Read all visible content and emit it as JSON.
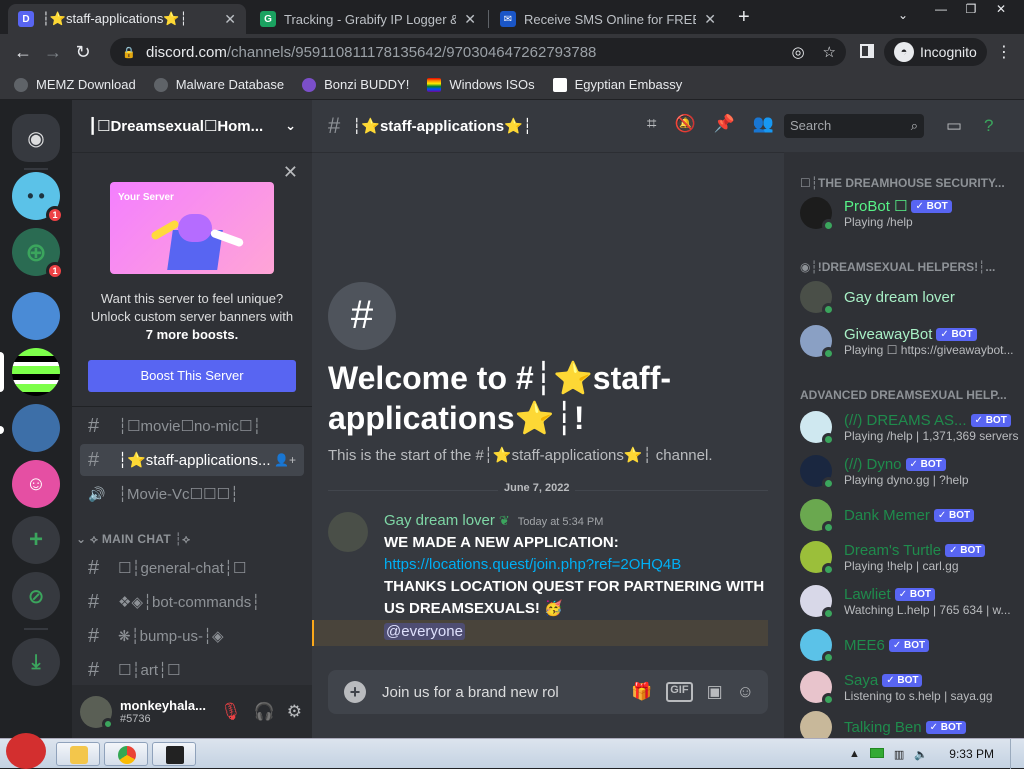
{
  "browser": {
    "tabs": [
      {
        "title": "┆⭐staff-applications⭐┆",
        "close": "✕",
        "icon": "discord-tab-icon"
      },
      {
        "title": "Tracking - Grabify IP Logger &",
        "close": "✕",
        "icon": "grabify-tab-icon"
      },
      {
        "title": "Receive SMS Online for FREE |",
        "close": "✕",
        "icon": "sms-tab-icon"
      }
    ],
    "new_tab": "+",
    "url_host": "discord.com",
    "url_path": "/channels/959110811178135642/970304647262793788",
    "incognito_label": "Incognito",
    "bookmarks": [
      "MEMZ Download",
      "Malware Database",
      "Bonzi BUDDY!",
      "Windows ISOs",
      "Egyptian Embassy"
    ]
  },
  "discord": {
    "guild_badges": [
      "1",
      "1"
    ],
    "server_name": "┃☐Dreamsexual☐Hom...",
    "boost_card": {
      "art_label": "Your Server",
      "line1": "Want this server to feel unique?",
      "line2": "Unlock custom server banners with",
      "line3": "7 more boosts.",
      "button": "Boost This Server"
    },
    "channels_top": [
      {
        "icon": "#",
        "name": "┆☐movie☐no-mic☐┆"
      },
      {
        "icon": "#",
        "name": "┆⭐staff-applications..."
      },
      {
        "icon": "🔊",
        "name": "┆Movie-Vc☐☐☐┆"
      }
    ],
    "category": "⟡ MAIN CHAT ┆⟡",
    "channels_main": [
      {
        "icon": "#",
        "name": "☐┆general-chat┆☐"
      },
      {
        "icon": "#",
        "name": "❖◈┆bot-commands┆"
      },
      {
        "icon": "#",
        "name": "❋┆bump-us-┆◈"
      },
      {
        "icon": "#",
        "name": "☐┆art┆☐"
      }
    ],
    "user": {
      "name": "monkeyhala...",
      "tag": "#5736"
    },
    "channel_header": {
      "hash": "#",
      "name": "┆⭐staff-applications⭐┆"
    },
    "search_placeholder": "Search",
    "welcome": {
      "icon": "#",
      "title": "Welcome to #┆⭐staff-applications⭐┆!",
      "subtitle": "This is the start of the #┆⭐staff-applications⭐┆ channel."
    },
    "date_divider": "June 7, 2022",
    "message": {
      "author": "Gay dream lover",
      "time": "Today at 5:34 PM",
      "line1": "WE MADE A NEW APPLICATION:",
      "link": "https://locations.quest/join.php?ref=2OHQ4B",
      "line2": "THANKS LOCATION QUEST FOR PARTNERING WITH US DREAMSEXUALS! 🥳",
      "mention": "@everyone"
    },
    "composer_text": "Join us for a brand new rol",
    "members": {
      "cat1": "☐┆THE DREAMHOUSE SECURITY...",
      "cat2": "◉┆!DREAMSEXUAL HELPERS!┆...",
      "cat3": "ADVANCED DREAMSEXUAL HELP...",
      "list": [
        {
          "name": "ProBot ☐",
          "bot": "✓ BOT",
          "status": "Playing /help",
          "color": "#57f287"
        },
        {
          "name": "Gay dream lover",
          "bot": "",
          "status": "",
          "color": "#a8f0c6"
        },
        {
          "name": "GiveawayBot",
          "bot": "✓ BOT",
          "status": "Playing ☐ https://giveawaybot...",
          "color": "#a8f0c6"
        },
        {
          "name": "(//) DREAMS AS...",
          "bot": "✓ BOT",
          "status": "Playing /help | 1,371,369 servers",
          "color": "#1f8b4c"
        },
        {
          "name": "(//) Dyno",
          "bot": "✓ BOT",
          "status": "Playing dyno.gg | ?help",
          "color": "#1f8b4c"
        },
        {
          "name": "Dank Memer",
          "bot": "✓ BOT",
          "status": "",
          "color": "#1f8b4c"
        },
        {
          "name": "Dream's Turtle",
          "bot": "✓ BOT",
          "status": "Playing !help | carl.gg",
          "color": "#1f8b4c"
        },
        {
          "name": "Lawliet",
          "bot": "✓ BOT",
          "status": "Watching L.help | 765 634 | w...",
          "color": "#1f8b4c"
        },
        {
          "name": "MEE6",
          "bot": "✓ BOT",
          "status": "",
          "color": "#1f8b4c"
        },
        {
          "name": "Saya",
          "bot": "✓ BOT",
          "status": "Listening to s.help | saya.gg",
          "color": "#1f8b4c"
        },
        {
          "name": "Talking Ben",
          "bot": "✓ BOT",
          "status": "",
          "color": "#1f8b4c"
        }
      ]
    }
  },
  "taskbar": {
    "clock": "9:33 PM"
  }
}
